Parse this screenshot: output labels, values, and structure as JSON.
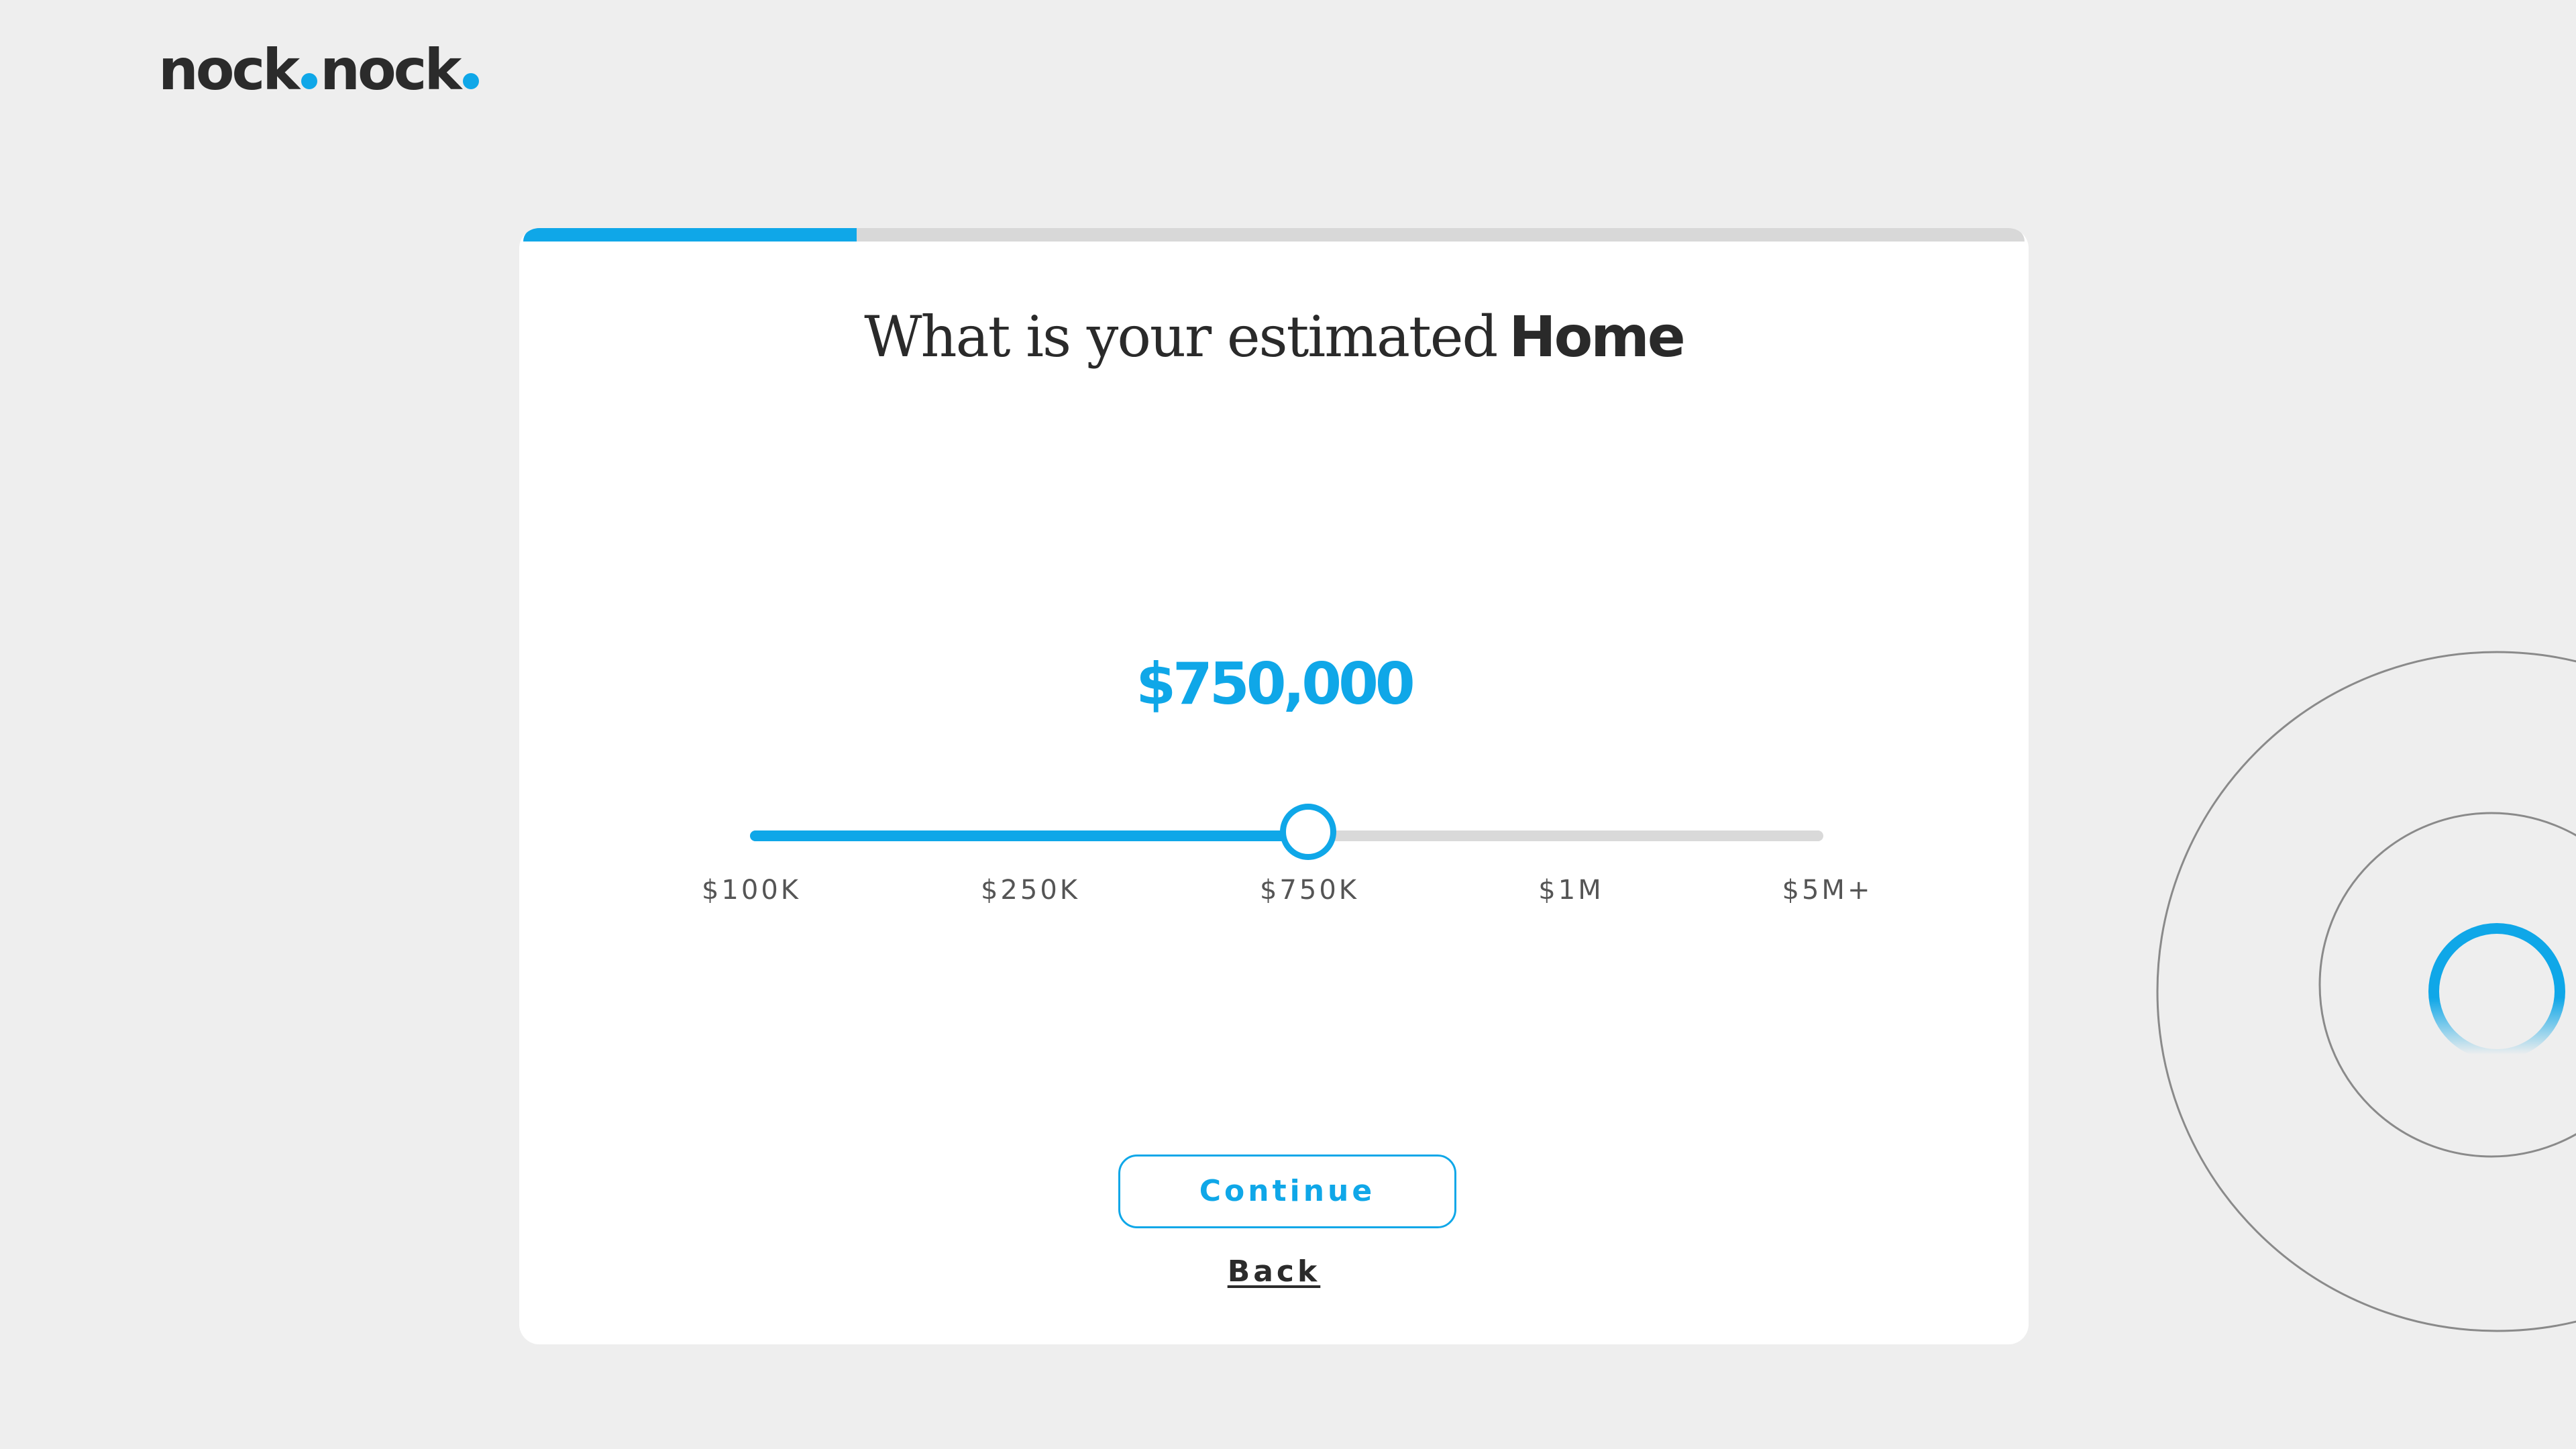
{
  "brand": {
    "logo_part1": "nock",
    "logo_part2": "nock",
    "logo_color": "#2b2b2b",
    "accent_color": "#0fa7e8"
  },
  "progress": {
    "fraction": 0.222
  },
  "question": {
    "prefix": "What is your estimated",
    "emphasis": "Home"
  },
  "slider": {
    "value_display": "$750,000",
    "fraction": 0.52,
    "ticks": [
      "$100K",
      "$250K",
      "$750K",
      "$1M",
      "$5M+"
    ]
  },
  "actions": {
    "continue_label": "Continue",
    "back_label": "Back"
  },
  "decoration": {
    "loader_icon": "spinner-ring-icon"
  }
}
